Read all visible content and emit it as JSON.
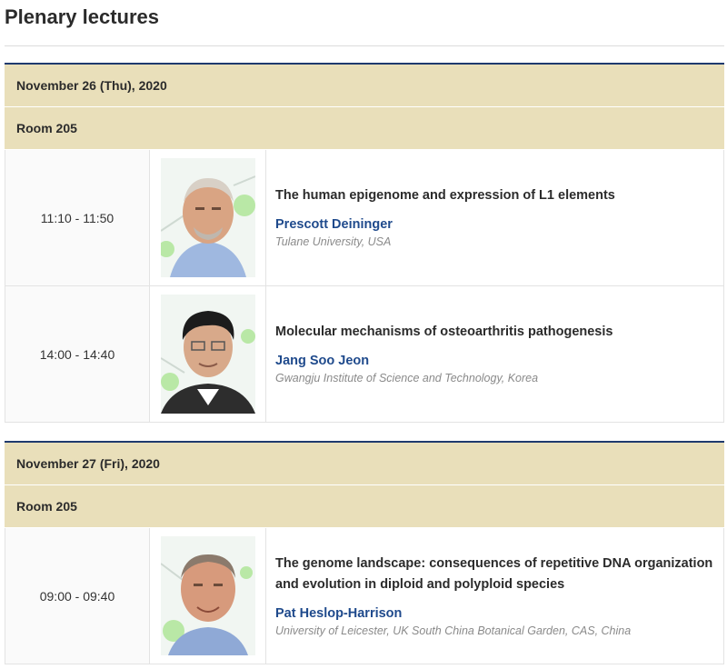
{
  "page": {
    "title": "Plenary lectures"
  },
  "days": [
    {
      "date": "November 26 (Thu), 2020",
      "room": "Room 205",
      "sessions": [
        {
          "time": "11:10 - 11:50",
          "title": "The human epigenome and expression of L1 elements",
          "speaker": "Prescott Deininger",
          "affiliation": "Tulane University, USA"
        },
        {
          "time": "14:00 - 14:40",
          "title": "Molecular mechanisms of osteoarthritis pathogenesis",
          "speaker": "Jang Soo Jeon",
          "affiliation": "Gwangju Institute of Science and Technology, Korea"
        }
      ]
    },
    {
      "date": "November 27 (Fri), 2020",
      "room": "Room 205",
      "sessions": [
        {
          "time": "09:00 - 09:40",
          "title": "The genome landscape: consequences of repetitive DNA organization and evolution in diploid and polyploid species",
          "speaker": "Pat Heslop-Harrison",
          "affiliation": "University of Leicester, UK South China Botanical Garden, CAS, China"
        }
      ]
    }
  ]
}
